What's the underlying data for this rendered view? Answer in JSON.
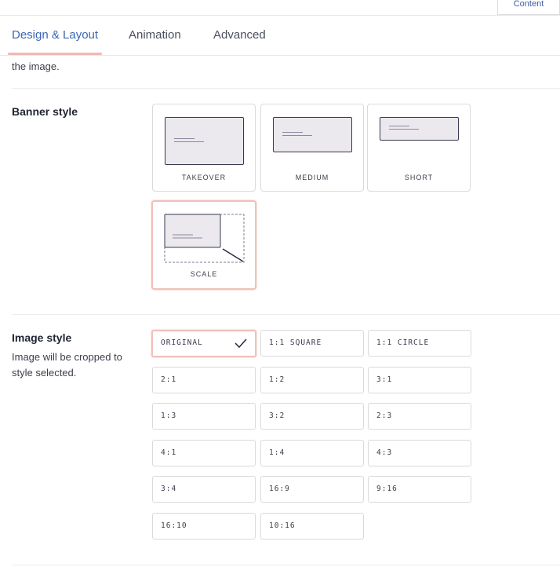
{
  "top": {
    "content_tab": "Content"
  },
  "tabs": [
    {
      "label": "Design & Layout",
      "active": true
    },
    {
      "label": "Animation",
      "active": false
    },
    {
      "label": "Advanced",
      "active": false
    }
  ],
  "intro_text": "the image.",
  "banner_style": {
    "title": "Banner style",
    "options": [
      {
        "label": "TAKEOVER",
        "selected": false
      },
      {
        "label": "MEDIUM",
        "selected": false
      },
      {
        "label": "SHORT",
        "selected": false
      },
      {
        "label": "SCALE",
        "selected": true
      }
    ]
  },
  "image_style": {
    "title": "Image style",
    "description": "Image will be cropped to style selected.",
    "options": [
      {
        "label": "ORIGINAL",
        "selected": true
      },
      {
        "label": "1:1 SQUARE",
        "selected": false
      },
      {
        "label": "1:1 CIRCLE",
        "selected": false
      },
      {
        "label": "2:1",
        "selected": false
      },
      {
        "label": "1:2",
        "selected": false
      },
      {
        "label": "3:1",
        "selected": false
      },
      {
        "label": "1:3",
        "selected": false
      },
      {
        "label": "3:2",
        "selected": false
      },
      {
        "label": "2:3",
        "selected": false
      },
      {
        "label": "4:1",
        "selected": false
      },
      {
        "label": "1:4",
        "selected": false
      },
      {
        "label": "4:3",
        "selected": false
      },
      {
        "label": "3:4",
        "selected": false
      },
      {
        "label": "16:9",
        "selected": false
      },
      {
        "label": "9:16",
        "selected": false
      },
      {
        "label": "16:10",
        "selected": false
      },
      {
        "label": "10:16",
        "selected": false
      }
    ]
  },
  "colors": {
    "accent_blue": "#3a66b5",
    "selection_border": "#f1c1ba",
    "preview_fill": "#ebe8ee",
    "preview_stroke": "#3a3850"
  }
}
